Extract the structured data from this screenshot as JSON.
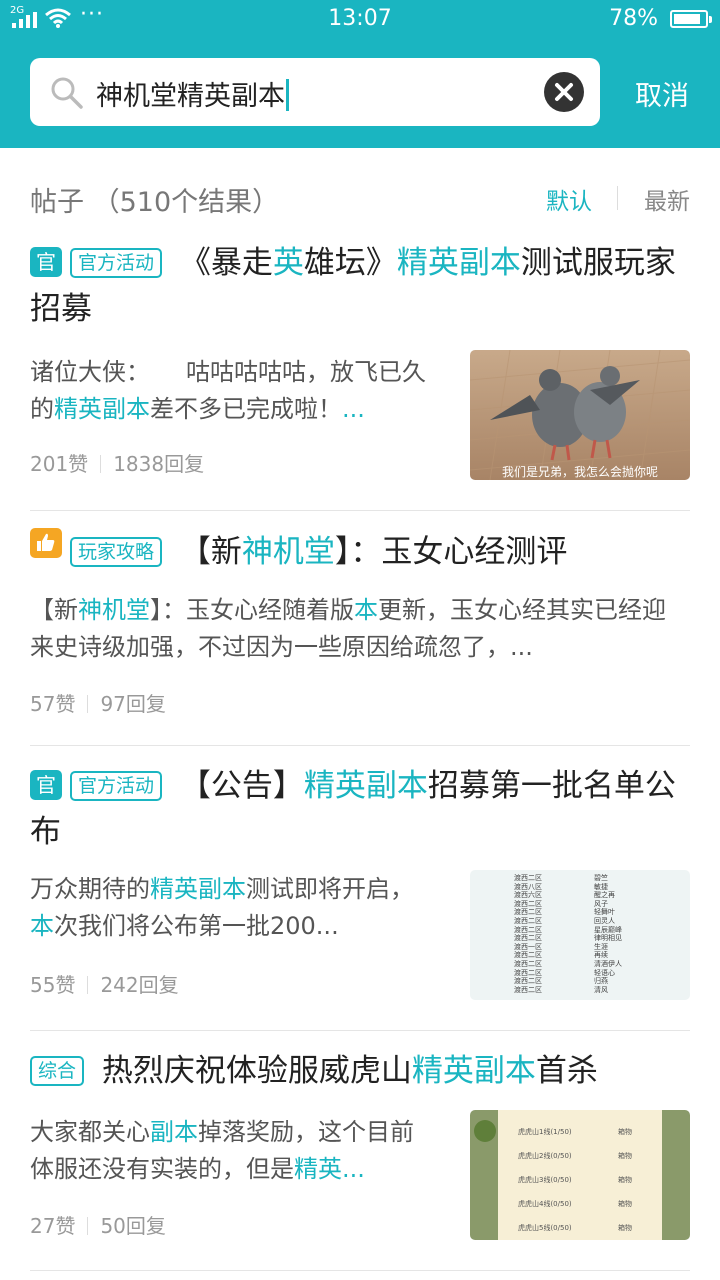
{
  "status": {
    "network": "2G",
    "time": "13:07",
    "battery": "78%"
  },
  "search": {
    "query": "神机堂精英副本",
    "cancel": "取消"
  },
  "filter": {
    "count_label": "帖子 （510个结果）",
    "sort_default": "默认",
    "sort_latest": "最新"
  },
  "colors": {
    "accent": "#1ab5c1",
    "tag_orange": "#f5a623"
  },
  "posts": [
    {
      "badge": "官",
      "tag": "官方活动",
      "title": [
        "《暴走",
        "英",
        "雄坛》",
        "精英副本",
        "测试服玩家招募"
      ],
      "excerpt": [
        "诸位大侠：　　咕咕咕咕咕，放飞已久的",
        "精英副本",
        "差不多已完成啦！",
        "..."
      ],
      "likes": "201赞",
      "replies": "1838回复",
      "image_caption": "我们是兄弟，我怎么会抛你呢"
    },
    {
      "badge_icon": "thumbs-up-icon",
      "tag": "玩家攻略",
      "title": [
        "【新",
        "神机堂",
        "】：玉女心经测评"
      ],
      "excerpt": [
        "【新",
        "神机堂",
        "】：玉女心经随着版",
        "本",
        "更新，玉女心经其实已经迎来史诗级加强，不过因为一些原因给疏忽了，..."
      ],
      "likes": "57赞",
      "replies": "97回复"
    },
    {
      "badge": "官",
      "tag": "官方活动",
      "title": [
        "【公告】",
        "精英副本",
        "招募第一批名单公布"
      ],
      "excerpt": [
        "万众期待的",
        "精英副本",
        "测试即将开启，",
        "本",
        "次我们将公布第一批200..."
      ],
      "likes": "55赞",
      "replies": "242回复",
      "image_list_left": [
        "渡西二区",
        "渡西八区",
        "渡西六区",
        "渡西二区",
        "渡西二区",
        "渡西二区",
        "渡西二区",
        "渡西二区",
        "渡西一区",
        "渡西二区",
        "渡西二区",
        "渡西二区",
        "渡西二区",
        "渡西二区"
      ],
      "image_list_right": [
        "碧竺",
        "敏捷",
        "醒之再",
        "风子",
        "轻舞叶",
        "回灵人",
        "星辰巅峰",
        "律明相见",
        "生涯",
        "再续",
        "清酒伊人",
        "轻语心",
        "归燕",
        "清风"
      ]
    },
    {
      "tag": "综合",
      "title": [
        "热烈庆祝体验服威虎山",
        "精英副本",
        "首杀"
      ],
      "excerpt": [
        "大家都关心",
        "副本",
        "掉落奖励，这个目前体服还没有实装的，但是",
        "精英",
        "..."
      ],
      "likes": "27赞",
      "replies": "50回复",
      "image_rows": [
        {
          "name": "虎虎山1线(1/50)",
          "val": "箱物"
        },
        {
          "name": "虎虎山2线(0/50)",
          "val": "箱物"
        },
        {
          "name": "虎虎山3线(0/50)",
          "val": "箱物"
        },
        {
          "name": "虎虎山4线(0/50)",
          "val": "箱物"
        },
        {
          "name": "虎虎山5线(0/50)",
          "val": "箱物"
        }
      ]
    }
  ]
}
